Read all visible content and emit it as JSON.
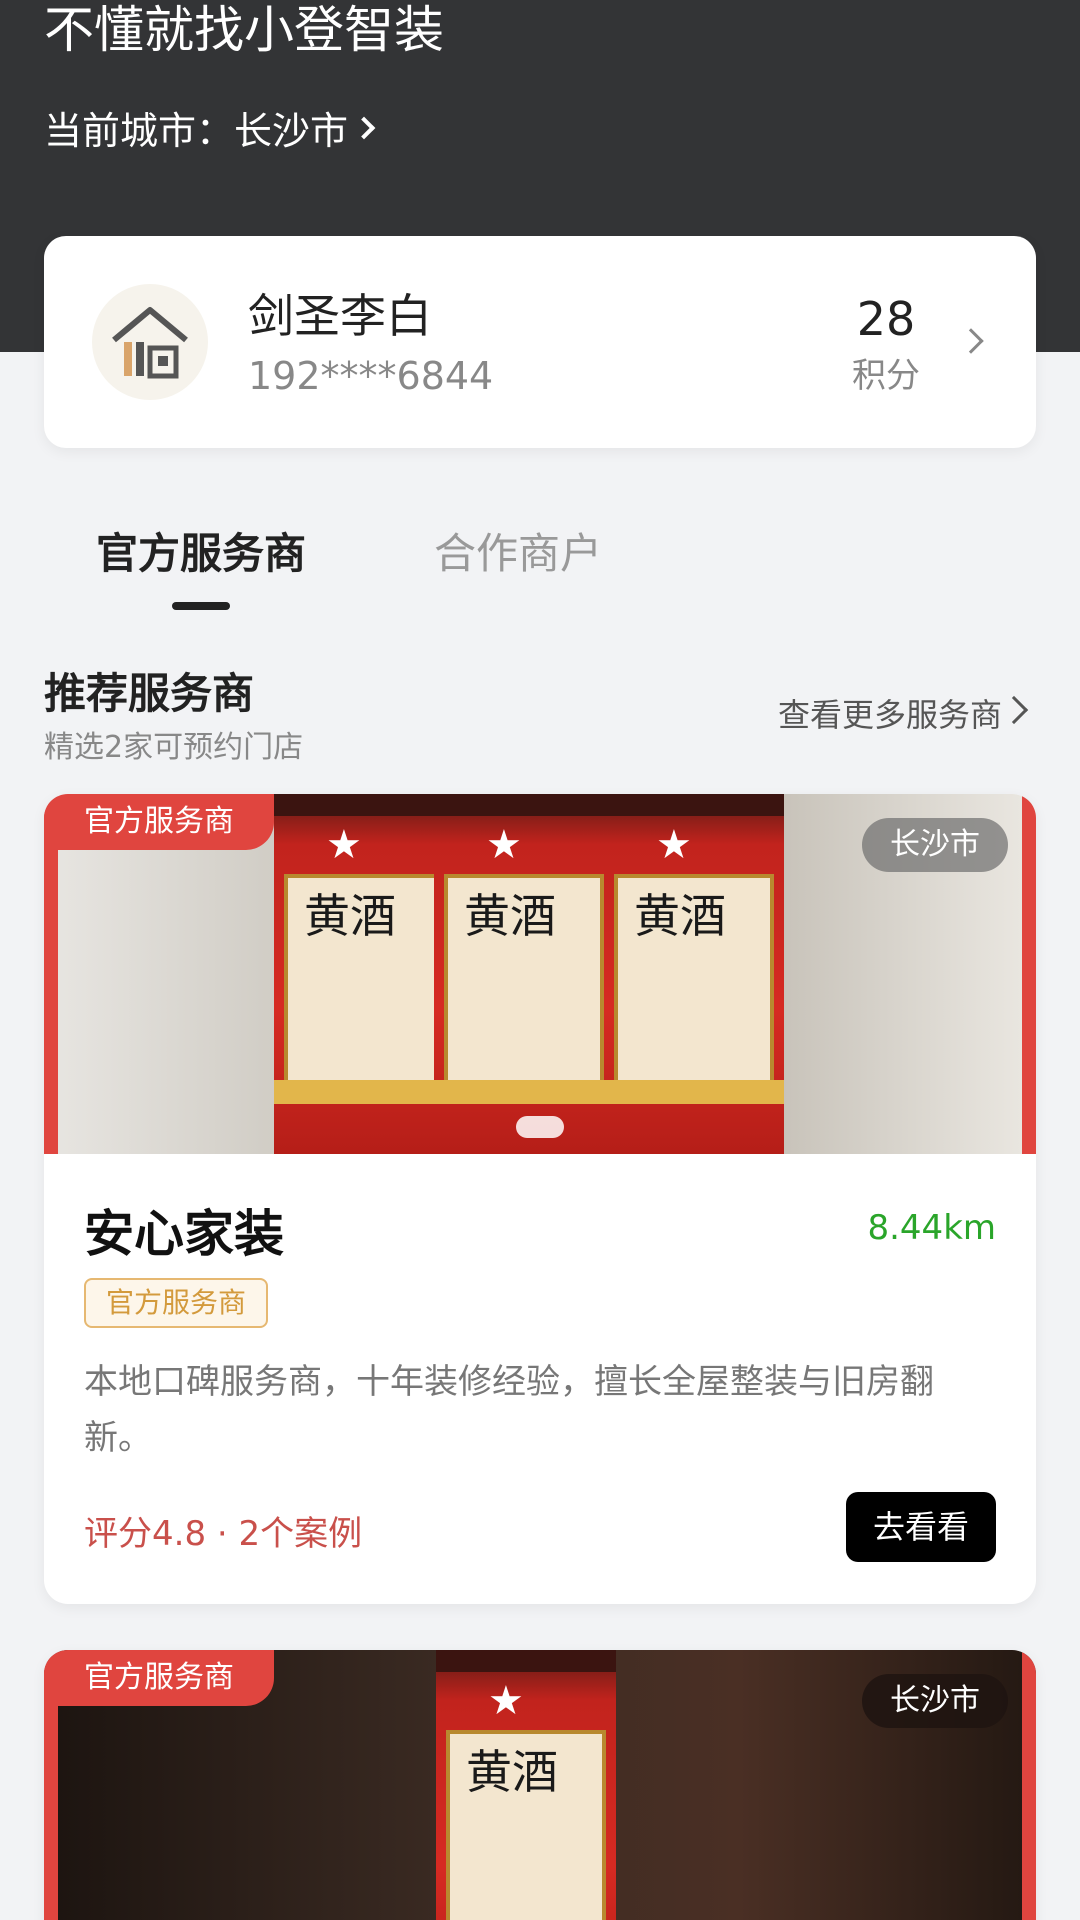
{
  "header": {
    "slogan": "不懂就找小登智装",
    "city_label": "当前城市：",
    "city_value": "长沙市"
  },
  "user": {
    "name": "剑圣李白",
    "phone": "192****6844",
    "points": "28",
    "points_label": "积分",
    "avatar_icon": "house-icon"
  },
  "tabs": [
    {
      "label": "官方服务商",
      "active": true
    },
    {
      "label": "合作商户",
      "active": false
    }
  ],
  "section": {
    "title": "推荐服务商",
    "subtitle": "精选2家可预约门店",
    "more_label": "查看更多服务商"
  },
  "stores": [
    {
      "badge": "官方服务商",
      "city": "长沙市",
      "name": "安心家装",
      "distance": "8.44km",
      "tag": "官方服务商",
      "description": "本地口碑服务商，十年装修经验，擅长全屋整装与旧房翻新。",
      "rating": "评分4.8 · 2个案例",
      "button": "去看看",
      "bottle_label": "黄酒"
    },
    {
      "badge": "官方服务商",
      "city": "长沙市",
      "bottle_label": "黄酒"
    }
  ],
  "colors": {
    "header_bg": "#333436",
    "accent_red": "#e0453f",
    "distance_green": "#2aa52a",
    "tag_gold": "#d39a3c"
  }
}
